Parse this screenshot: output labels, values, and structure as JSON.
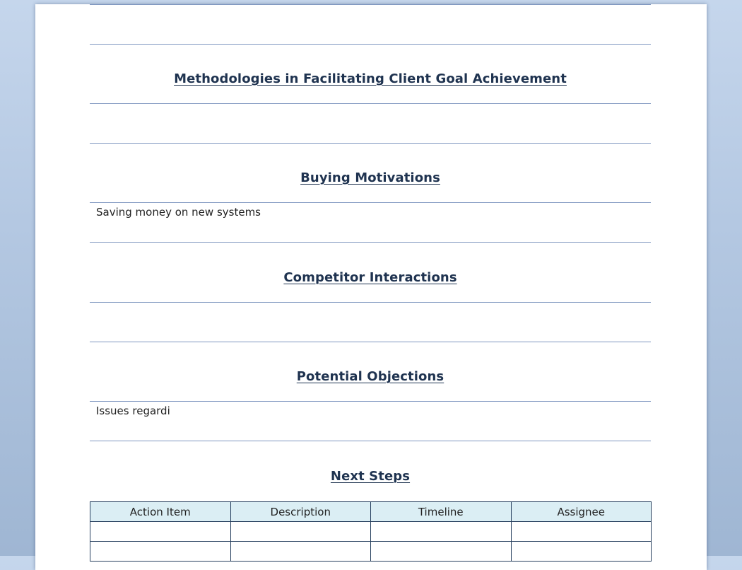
{
  "sections": {
    "methodologies": {
      "heading": "Methodologies in Facilitating Client Goal Achievement",
      "body": ""
    },
    "buying_motivations": {
      "heading": "Buying Motivations",
      "body": "Saving money on new systems"
    },
    "competitor_interactions": {
      "heading": "Competitor Interactions",
      "body": ""
    },
    "potential_objections": {
      "heading": "Potential Objections",
      "body": "Issues regardi"
    },
    "next_steps": {
      "heading": "Next Steps"
    }
  },
  "next_steps_table": {
    "columns": [
      "Action Item",
      "Description",
      "Timeline",
      "Assignee"
    ],
    "rows": [
      [
        "",
        "",
        "",
        ""
      ],
      [
        "",
        "",
        "",
        ""
      ]
    ]
  }
}
